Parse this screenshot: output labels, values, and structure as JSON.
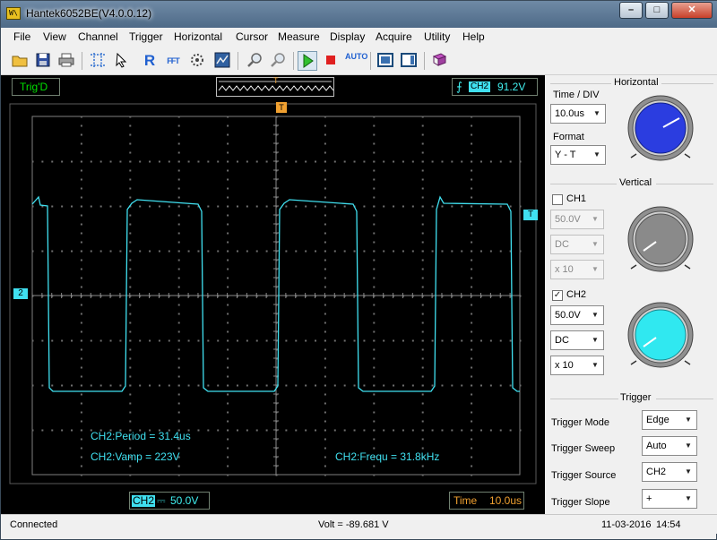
{
  "window": {
    "title": "Hantek6052BE(V4.0.0.12)",
    "icon_text": "W\\"
  },
  "window_controls": {
    "minimize": "–",
    "maximize": "□",
    "close": "✕"
  },
  "menu": [
    "File",
    "View",
    "Channel",
    "Trigger",
    "Horizontal",
    "Cursor",
    "Measure",
    "Display",
    "Acquire",
    "Utility",
    "Help"
  ],
  "toolbar": {
    "icons": [
      "open-icon",
      "save-icon",
      "print-icon",
      "cursor-cross-icon",
      "pointer-icon",
      "reference-icon",
      "fft-icon",
      "math-icon",
      "wave-icon",
      "zoom-in-icon",
      "zoom-out-icon",
      "run-icon",
      "stop-icon",
      "auto-icon",
      "fit-icon",
      "panel-icon",
      "help-book-icon"
    ],
    "reference_label": "R",
    "fft_label": "FFT",
    "auto_label": "AUTO"
  },
  "trigger_status": "Trig'D",
  "trigger_marker": "T",
  "trigger_info": {
    "channel": "CH2",
    "level": "91.2V"
  },
  "scope": {
    "colors": {
      "trace": "#40e0f0",
      "grid": "#808080",
      "trigger_marker": "#f0a030"
    },
    "ch2_marker": "2",
    "trigger_level_marker": "T",
    "time_marker": "T",
    "measurements": {
      "period": "CH2:Period = 31.4us",
      "vamp": "CH2:Vamp = 223V",
      "freq": "CH2:Frequ = 31.8kHz"
    }
  },
  "bottom": {
    "ch_label": "CH2",
    "coupling_symbol": "⎓",
    "ch_volts": "50.0V",
    "time_label": "Time",
    "time_value": "10.0us"
  },
  "panel": {
    "horizontal": {
      "title": "Horizontal",
      "time_div_label": "Time / DIV",
      "time_div_value": "10.0us",
      "format_label": "Format",
      "format_value": "Y - T"
    },
    "vertical": {
      "title": "Vertical",
      "ch1": {
        "label": "CH1",
        "checked": false,
        "volts": "50.0V",
        "coupling": "DC",
        "probe": "x 10"
      },
      "ch2": {
        "label": "CH2",
        "checked": true,
        "volts": "50.0V",
        "coupling": "DC",
        "probe": "x 10"
      }
    },
    "trigger": {
      "title": "Trigger",
      "mode_label": "Trigger Mode",
      "mode_value": "Edge",
      "sweep_label": "Trigger Sweep",
      "sweep_value": "Auto",
      "source_label": "Trigger Source",
      "source_value": "CH2",
      "slope_label": "Trigger Slope",
      "slope_value": "+"
    }
  },
  "statusbar": {
    "connection": "Connected",
    "readout": "Volt = -89.681 V",
    "date": "11-03-2016",
    "time": "14:54"
  }
}
